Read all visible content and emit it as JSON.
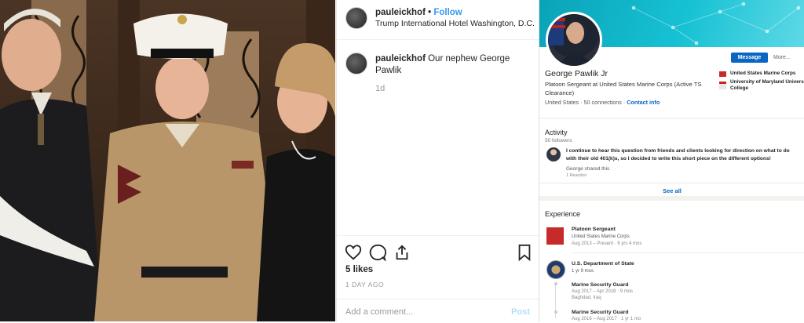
{
  "instagram": {
    "username": "pauleickhof",
    "follow_label": "Follow",
    "location": "Trump International Hotel Washington, D.C.",
    "caption_user": "pauleickhof",
    "caption_text": "Our nephew George Pawlik",
    "caption_time": "1d",
    "likes": "5 likes",
    "posted_ago": "1 DAY AGO",
    "comment_placeholder": "Add a comment...",
    "post_label": "Post"
  },
  "linkedin": {
    "name": "George Pawlik Jr",
    "headline": "Platoon Sergeant at United States Marine Corps (Active TS Clearance)",
    "location": "United States",
    "connections": "50 connections",
    "contact_info": "Contact info",
    "message_label": "Message",
    "more_label": "More...",
    "orgs": [
      "United States Marine Corps",
      "University of Maryland University College"
    ],
    "activity": {
      "title": "Activity",
      "followers": "50 followers",
      "post_text": "I continue to hear this question from friends and clients looking for direction on what to do with their old 401(k)s, so I decided to write this short piece on the different options!",
      "shared": "George shared this",
      "reactions": "1 Reaction",
      "see_all": "See all"
    },
    "experience": {
      "title": "Experience",
      "job1_role": "Platoon Sergeant",
      "job1_org": "United States Marine Corps",
      "job1_dates": "Aug 2013 – Present · 6 yrs 4 mos",
      "job2_org": "U.S. Department of State",
      "job2_total": "1 yr 9 mos",
      "job2_role1": "Marine Security Guard",
      "job2_role1_dates": "Aug 2017 – Apr 2018 · 9 mos",
      "job2_role1_loc": "Baghdad, Iraq",
      "job2_role2": "Marine Security Guard",
      "job2_role2_dates": "Aug 2016 – Aug 2017 · 1 yr 1 mo"
    }
  },
  "colors": {
    "ig_blue": "#3897f0",
    "li_blue": "#0a66c2",
    "banner": "#17c2d4"
  }
}
